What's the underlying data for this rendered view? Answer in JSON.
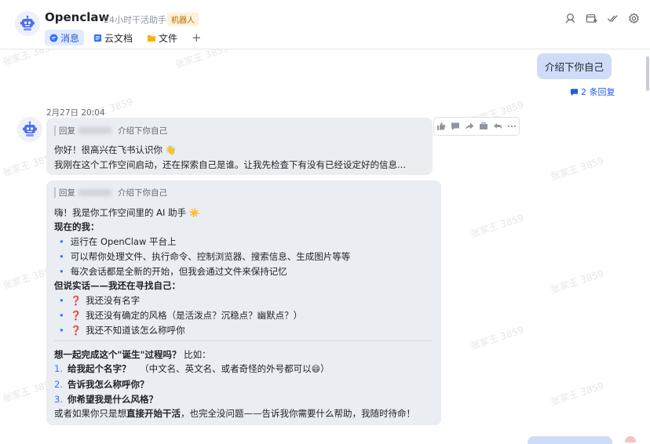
{
  "header": {
    "title": "Openclaw",
    "subtitle": "24小时干活助手",
    "badge": "机器人",
    "tabs": [
      {
        "label": "消息",
        "icon": "chat-bubble-icon"
      },
      {
        "label": "云文档",
        "icon": "doc-icon"
      },
      {
        "label": "文件",
        "icon": "folder-icon"
      }
    ],
    "add_tab": "+",
    "tools": [
      "search-person-icon",
      "add-tab-icon",
      "check-double-icon",
      "settings-icon"
    ]
  },
  "conversation": {
    "my_message": "介绍下你自己",
    "reply_count": "2 条回复",
    "date": "2月27日 20:04",
    "reply1": {
      "quote_prefix": "回复",
      "quote_text": "介绍下你自己",
      "greeting": "你好！很高兴在飞书认识你",
      "greeting_emoji": "👋",
      "line2": "我刚在这个工作空间启动，还在探索自己是谁。让我先检查下有没有已经设定好的信息..."
    },
    "reply2": {
      "quote_prefix": "回复",
      "quote_text": "介绍下你自己",
      "intro": "嗨！我是你工作空间里的 AI 助手",
      "intro_emoji": "☀️",
      "section1_title": "现在的我：",
      "section1_items": [
        "运行在 OpenClaw 平台上",
        "可以帮你处理文件、执行命令、控制浏览器、搜索信息、生成图片等等",
        "每次会话都是全新的开始，但我会通过文件来保持记忆"
      ],
      "section2_title": "但说实话——我还在寻找自己：",
      "section2_items": [
        "我还没有名字",
        "我还没有确定的风格（是活泼点？沉稳点？幽默点？）",
        "我还不知道该怎么称呼你"
      ],
      "question_mark": "❓",
      "cta_bold": "想一起完成这个\"诞生\"过程吗？",
      "cta_rest": "比如：",
      "steps": [
        {
          "num": "1.",
          "bold": "给我起个名字？",
          "rest": "（中文名、英文名、或者奇怪的外号都可以",
          "emoji": "😄",
          "tail": "）"
        },
        {
          "num": "2.",
          "bold": "告诉我怎么称呼你？",
          "rest": "",
          "emoji": "",
          "tail": ""
        },
        {
          "num": "3.",
          "bold": "你希望我是什么风格？",
          "rest": "",
          "emoji": "",
          "tail": ""
        }
      ],
      "closing_pre": "或者如果你只是想",
      "closing_bold": "直接开始干活",
      "closing_post": "，也完全没问题——告诉我你需要什么帮助，我随时待命！"
    }
  },
  "actions": [
    "thumbs-up-icon",
    "comment-icon",
    "forward-icon",
    "share-icon",
    "quote-reply-icon",
    "more-icon"
  ],
  "watermark": "张家王 3859",
  "colors": {
    "accent": "#3370ff",
    "my_bubble": "#cfdcf9",
    "bot_bubble": "#eaedf1"
  }
}
